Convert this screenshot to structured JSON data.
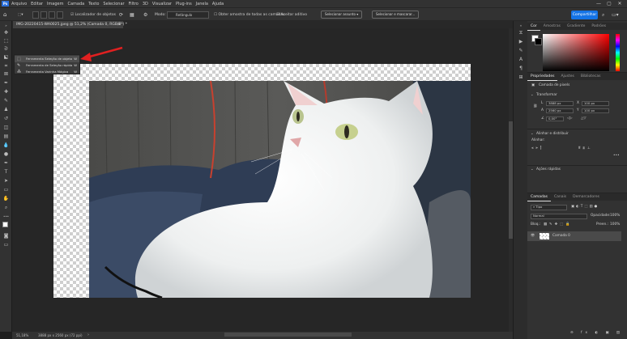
{
  "app": {
    "logo": "Ps",
    "accent": "#1473e6"
  },
  "menubar": {
    "items": [
      "Arquivo",
      "Editar",
      "Imagem",
      "Camada",
      "Texto",
      "Selecionar",
      "Filtro",
      "3D",
      "Visualizar",
      "Plug-ins",
      "Janela",
      "Ajuda"
    ],
    "min_icon": "—",
    "max_icon": "▢",
    "close_icon": "✕"
  },
  "options": {
    "home_icon": "⌂",
    "sample_all": "Localizador de objetos",
    "mode_label": "Modo:",
    "mode_value": "Retângulo",
    "sample_layers": "Obter amostra de todas as camadas",
    "auto_enhance": "Aceitar aditivo",
    "select_subject": "Selecionar assunto",
    "select_mask": "Selecionar e mascarar...",
    "share": "Compartilhar"
  },
  "document": {
    "tab_title": "IMG-20220415-WA0025.jpeg @ 51,2% (Camada 0, RGB/8*) *",
    "close_icon": "×"
  },
  "flyout": {
    "items": [
      {
        "label": "Ferramenta Seleção de objeto",
        "key": "W",
        "icon": "⬚",
        "selected": true
      },
      {
        "label": "Ferramenta de Seleção rápida",
        "key": "W",
        "icon": "✎",
        "selected": false
      },
      {
        "label": "Ferramenta Varinha Mágica",
        "key": "W",
        "icon": "⁂",
        "selected": false
      }
    ]
  },
  "status": {
    "zoom": "51,18%",
    "dims": "3888 px x 2560 px (72 ppi)",
    "arrow_icon": "›"
  },
  "color_panel": {
    "tabs": [
      "Cor",
      "Amostras",
      "Gradiente",
      "Padrões"
    ],
    "fg": "#ffffff",
    "bg": "#000000"
  },
  "properties": {
    "tabs": [
      "Propriedades",
      "Ajustes",
      "Bibliotecas"
    ],
    "layer_kind": "Camada de pixels",
    "transform_title": "Transformar",
    "w": "3888 px",
    "h": "2560 px",
    "x": "100 px",
    "y": "100 px",
    "angle": "0,00°",
    "align_title": "Alinhar e distribuir",
    "align_label": "Alinhar:",
    "quick_title": "Ações rápidas",
    "more": "•••"
  },
  "layers": {
    "tabs": [
      "Camadas",
      "Canais",
      "Demarcadores"
    ],
    "filter_value": "Tipo",
    "blend_mode": "Normal",
    "opacity_label": "Opacidade:",
    "opacity_value": "100%",
    "lock_label": "Bloq.:",
    "fill_label": "Preen.:",
    "fill_value": "100%",
    "layer_name": "Camada 0",
    "bottom_icons": [
      "⊖",
      "fx",
      "◐",
      "▣",
      "▤",
      "⊕",
      "🗑"
    ]
  }
}
